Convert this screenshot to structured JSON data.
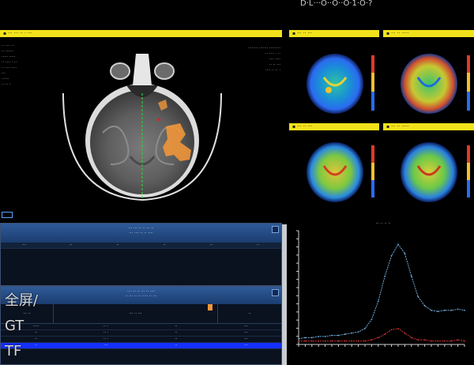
{
  "header": {
    "corner_text": "D·L···O··O··O·1·O·?"
  },
  "left_viewer": {
    "title": "▪ ··· ··· ·· · ···",
    "patient_info": [
      "·· ···· ··",
      "·· ······",
      "····· ·····",
      "·· ···· · ··",
      "·· ···· ····",
      "···",
      "······",
      "·· ·· ·"
    ],
    "right_info": [
      "········ ······· ·········",
      "·· ···· · ··",
      "···· ····",
      "·· ·· ···",
      "···· ·· ·· ·"
    ]
  },
  "perfusion_maps": [
    {
      "title": "▪ ··· ·· ···"
    },
    {
      "title": "▪ ··· ·· ·····"
    },
    {
      "title": "▪ ··· ·· ···"
    },
    {
      "title": "▪ ··· ·· ·····"
    }
  ],
  "table1": {
    "title": "··· ··· ·· ·· ··· ··",
    "subtitle": "··· ···· ·· ·· ····",
    "cols": [
      "···",
      "··",
      "··",
      "··",
      "··",
      "··"
    ]
  },
  "table2": {
    "title": "··· ··· ·· ··· ·· ····",
    "subtitle": "·· ··· ·· ·· ····· ·· ···",
    "left_header": "··· ··",
    "mid_header": "··· ·· ···",
    "right_header": "··",
    "rows": [
      [
        "·····",
        "·· ·",
        "··",
        "···"
      ],
      [
        "··",
        "·· ·",
        "··",
        "···"
      ],
      [
        "··",
        "·· ·",
        "··",
        "···"
      ],
      [
        "··",
        "···",
        "··",
        "···"
      ]
    ]
  },
  "side_labels": {
    "fullscreen": "全屏/",
    "gt": "GT",
    "tf": "TF"
  },
  "chart_data": {
    "type": "line",
    "title": "··· ·· ·· ··",
    "xlabel": "",
    "ylabel": "",
    "series": [
      {
        "color": "#6fa8d6",
        "values": [
          5,
          6,
          6,
          7,
          7,
          8,
          8,
          9,
          10,
          11,
          14,
          22,
          38,
          60,
          78,
          88,
          80,
          60,
          42,
          34,
          30,
          29,
          30,
          30,
          31,
          30
        ]
      },
      {
        "color": "#c83232",
        "values": [
          3,
          3,
          3,
          3,
          3,
          3,
          3,
          3,
          3,
          3,
          3,
          4,
          6,
          9,
          13,
          14,
          10,
          6,
          4,
          4,
          3,
          3,
          3,
          3,
          4,
          3
        ]
      }
    ],
    "ylim": [
      0,
      100
    ]
  }
}
